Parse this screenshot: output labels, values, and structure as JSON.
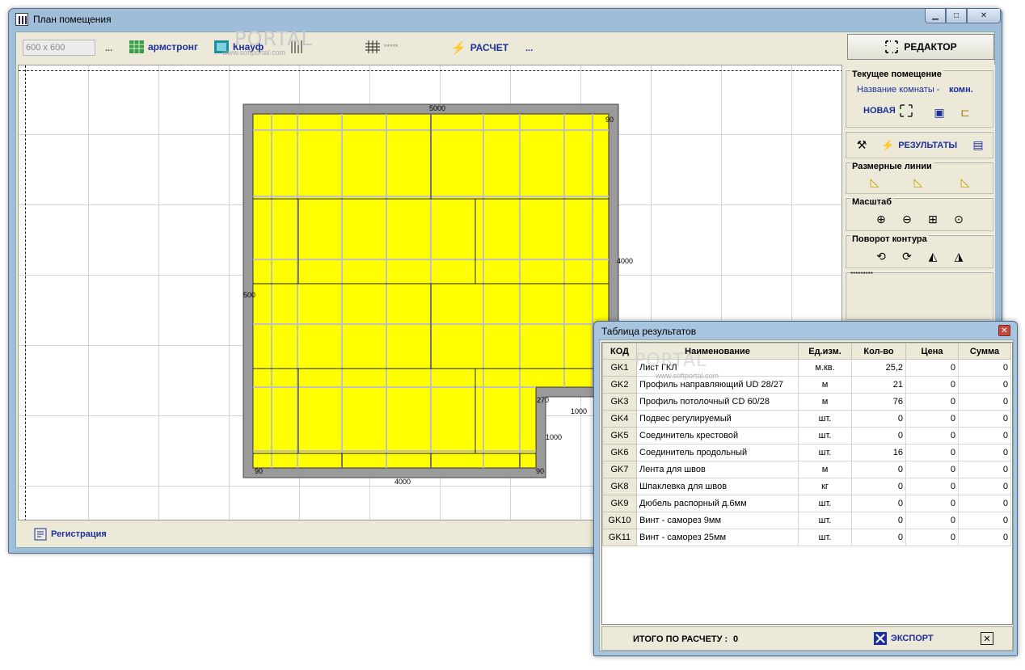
{
  "main_window": {
    "title": "План помещения",
    "tile_size": "600 x 600",
    "toolbar": {
      "ellipsis1": "...",
      "armstrong_label": "армстронг",
      "knauf_label": "Кнауф",
      "grid_stars": "*****",
      "calc_label": "РАСЧЕТ",
      "ellipsis2": "..."
    },
    "editor_label": "РЕДАКТОР",
    "watermark": "PORTAL",
    "watermark_url": "www.softportal.com"
  },
  "side_panel": {
    "current_room_title": "Текущее помещение",
    "room_name_label": "Название комнаты -",
    "room_name_value": "комн.",
    "new_label": "НОВАЯ",
    "results_label": "РЕЗУЛЬТАТЫ",
    "dim_lines_title": "Размерные линии",
    "scale_title": "Масштаб",
    "rotate_title": "Поворот контура",
    "stars": "*********"
  },
  "plan": {
    "dims": {
      "top": "5000",
      "top_right": "90",
      "right": "4000",
      "left": "500",
      "notch_left": "270",
      "notch_top": "1000",
      "notch_right": "1000",
      "bottom": "4000",
      "bottom_left": "90",
      "bottom_right": "90"
    }
  },
  "status": {
    "register_label": "Регистрация"
  },
  "results_dialog": {
    "title": "Таблица результатов",
    "columns": [
      "КОД",
      "Наименование",
      "Ед.изм.",
      "Кол-во",
      "Цена",
      "Сумма"
    ],
    "rows": [
      [
        "GK1",
        "Лист ГКЛ",
        "м.кв.",
        "25,2",
        "0",
        "0"
      ],
      [
        "GK2",
        "Профиль направляющий UD 28/27",
        "м",
        "21",
        "0",
        "0"
      ],
      [
        "GK3",
        "Профиль потолочный CD 60/28",
        "м",
        "76",
        "0",
        "0"
      ],
      [
        "GK4",
        "Подвес регулируемый",
        "шт.",
        "0",
        "0",
        "0"
      ],
      [
        "GK5",
        "Соединитель крестовой",
        "шт.",
        "0",
        "0",
        "0"
      ],
      [
        "GK6",
        "Соединитель продольный",
        "шт.",
        "16",
        "0",
        "0"
      ],
      [
        "GK7",
        "Лента для швов",
        "м",
        "0",
        "0",
        "0"
      ],
      [
        "GK8",
        "Шпаклевка для швов",
        "кг",
        "0",
        "0",
        "0"
      ],
      [
        "GK9",
        "Дюбель распорный д.6мм",
        "шт.",
        "0",
        "0",
        "0"
      ],
      [
        "GK10",
        "Винт - саморез 9мм",
        "шт.",
        "0",
        "0",
        "0"
      ],
      [
        "GK11",
        "Винт - саморез 25мм",
        "шт.",
        "0",
        "0",
        "0"
      ]
    ],
    "total_label": "ИТОГО ПО РАСЧЕТУ :",
    "total_value": "0",
    "export_label": "ЭКСПОРТ"
  }
}
